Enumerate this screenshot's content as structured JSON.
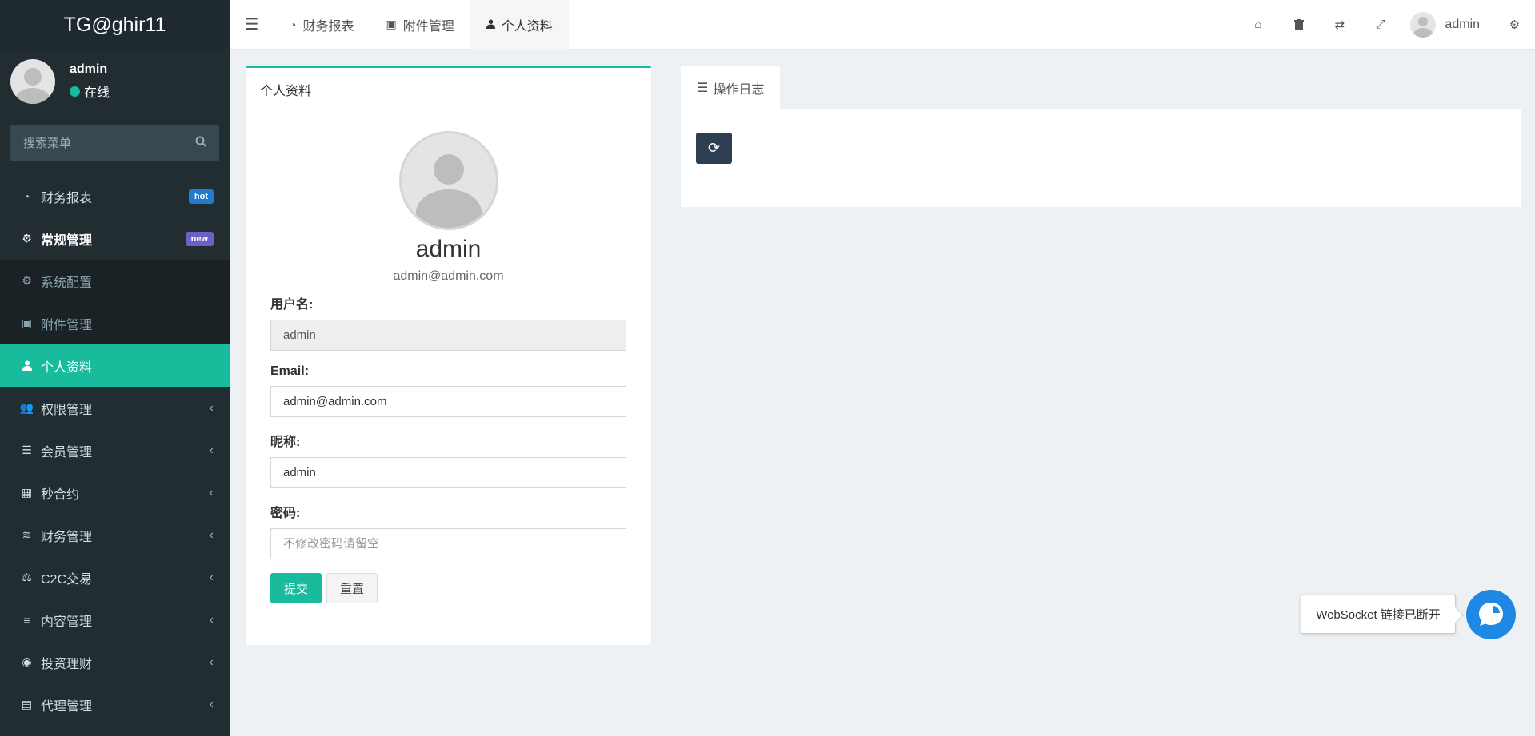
{
  "app": {
    "logo_text": "TG@ghir11"
  },
  "user": {
    "name": "admin",
    "status": "在线",
    "email": "admin@admin.com"
  },
  "sidebar": {
    "search_placeholder": "搜索菜单",
    "items": [
      {
        "label": "财务报表",
        "icon": "dashboard-icon",
        "badge": "hot"
      },
      {
        "label": "常规管理",
        "icon": "cogs-icon",
        "badge": "new"
      },
      {
        "label": "系统配置",
        "icon": "gear-icon"
      },
      {
        "label": "附件管理",
        "icon": "image-icon"
      },
      {
        "label": "个人资料",
        "icon": "user-icon"
      },
      {
        "label": "权限管理",
        "icon": "group-icon"
      },
      {
        "label": "会员管理",
        "icon": "list-icon"
      },
      {
        "label": "秒合约",
        "icon": "calendar-icon"
      },
      {
        "label": "财务管理",
        "icon": "database-icon"
      },
      {
        "label": "C2C交易",
        "icon": "balance-icon"
      },
      {
        "label": "内容管理",
        "icon": "align-left-icon"
      },
      {
        "label": "投资理财",
        "icon": "compass-icon"
      },
      {
        "label": "代理管理",
        "icon": "briefcase-icon"
      }
    ]
  },
  "topbar": {
    "tabs": [
      {
        "label": "财务报表",
        "icon": "dashboard-icon"
      },
      {
        "label": "附件管理",
        "icon": "image-icon"
      },
      {
        "label": "个人资料",
        "icon": "user-icon"
      }
    ],
    "user_name": "admin"
  },
  "profile": {
    "card_title": "个人资料",
    "name": "admin",
    "email": "admin@admin.com",
    "fields": {
      "username_label": "用户名:",
      "username_value": "admin",
      "email_label": "Email:",
      "email_value": "admin@admin.com",
      "nickname_label": "昵称:",
      "nickname_value": "admin",
      "password_label": "密码:",
      "password_placeholder": "不修改密码请留空"
    },
    "submit_label": "提交",
    "reset_label": "重置"
  },
  "log_panel": {
    "tab_label": "操作日志"
  },
  "websocket": {
    "message": "WebSocket 链接已断开"
  },
  "colors": {
    "accent": "#18bc9c",
    "sidebar_bg": "#222d32",
    "hot_badge": "#1e7bcf",
    "new_badge": "#6b61c2",
    "chat_button": "#1e88e5"
  }
}
